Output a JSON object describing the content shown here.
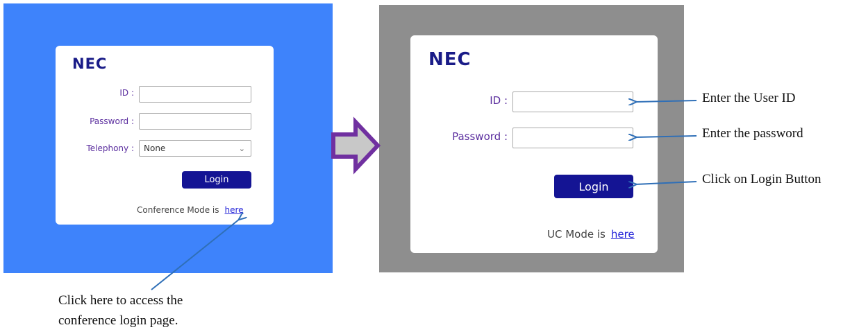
{
  "left_login": {
    "logo": "NEC",
    "id_label": "ID :",
    "password_label": "Password :",
    "telephony_label": "Telephony :",
    "telephony_value": "None",
    "login_button": "Login",
    "mode_text": "Conference Mode is",
    "mode_link": "here"
  },
  "right_login": {
    "logo": "NEC",
    "id_label": "ID :",
    "password_label": "Password :",
    "login_button": "Login",
    "mode_text": "UC Mode is",
    "mode_link": "here"
  },
  "annotations": {
    "user_id": "Enter the User ID",
    "password": "Enter the password",
    "login": "Click on Login Button",
    "conference_line1": "Click here to access the",
    "conference_line2": "conference login page."
  },
  "colors": {
    "left_background": "#3e83fb",
    "right_background": "#8e8e8e",
    "login_button": "#141494",
    "arrow": "#2f6fb7",
    "transition_arrow_fill": "#c8c8c8",
    "transition_arrow_stroke": "#7030a0"
  }
}
